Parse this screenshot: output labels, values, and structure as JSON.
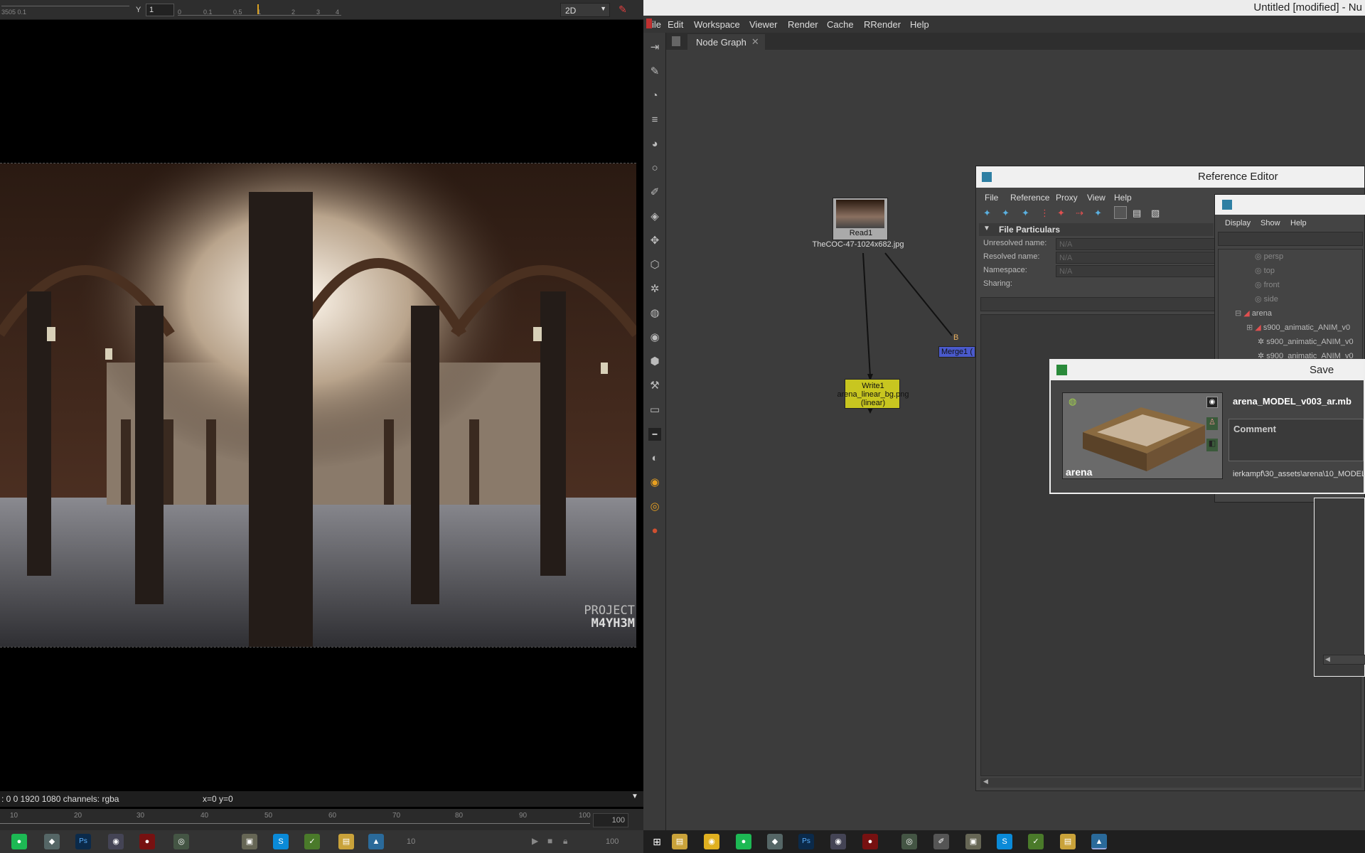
{
  "viewer": {
    "toolbar": {
      "ruler_left": "3505  0.1",
      "y_label": "Y",
      "y_value": "1",
      "ruler_marks": [
        "0",
        "0.1",
        "0.5",
        "1",
        "2",
        "3",
        "4"
      ],
      "mode": "2D"
    },
    "watermark_line1": "PROJECT",
    "watermark_line2": "M4YH3M",
    "status": {
      "format": ": 0 0 1920 1080 channels: rgba",
      "coords": "x=0 y=0"
    },
    "timeline": {
      "ticks": [
        "10",
        "20",
        "30",
        "40",
        "50",
        "60",
        "70",
        "80",
        "90",
        "100"
      ],
      "end_frame": "100",
      "bottom_frame": "10",
      "bottom_end": "100"
    }
  },
  "nuke": {
    "window_title": "Untitled [modified] - Nu",
    "menu": [
      "ile",
      "Edit",
      "Workspace",
      "Viewer",
      "Render",
      "Cache",
      "RRender",
      "Help"
    ],
    "tab_label": "Node Graph",
    "nodes": {
      "read": {
        "name": "Read1",
        "file": "TheCOC-47-1024x682.jpg"
      },
      "write": {
        "name": "Write1",
        "file": "arena_linear_bg.png",
        "colorspace": "(linear)"
      },
      "merge": {
        "name": "Merge1 (",
        "input": "B"
      }
    }
  },
  "reference_editor": {
    "title": "Reference Editor",
    "menu": [
      "File",
      "Reference",
      "Proxy",
      "View",
      "Help"
    ],
    "section": "File Particulars",
    "fields": [
      {
        "label": "Unresolved name:",
        "value": "N/A"
      },
      {
        "label": "Resolved name:",
        "value": "N/A"
      },
      {
        "label": "Namespace:",
        "value": "N/A"
      },
      {
        "label": "Sharing:",
        "value": ""
      }
    ]
  },
  "outliner": {
    "menu": [
      "Display",
      "Show",
      "Help"
    ],
    "items": [
      "persp",
      "top",
      "front",
      "side",
      "arena",
      "s900_animatic_ANIM_v0",
      "s900_animatic_ANIM_v0",
      "s900_animatic_ANIM_v0"
    ]
  },
  "save_dialog": {
    "title": "Save",
    "filename": "arena_MODEL_v003_ar.mb",
    "asset_name": "arena",
    "comment_placeholder": "Comment",
    "path": "ierkampf\\30_assets\\arena\\10_MODEL\\"
  },
  "taskbar": {
    "icons": [
      "windows-start",
      "file-explorer",
      "chrome",
      "spotify",
      "app-generic",
      "photoshop",
      "app-generic",
      "app-red",
      "app-eye",
      "app-pen",
      "app-film",
      "skype",
      "app-green",
      "folder",
      "nuke"
    ]
  }
}
